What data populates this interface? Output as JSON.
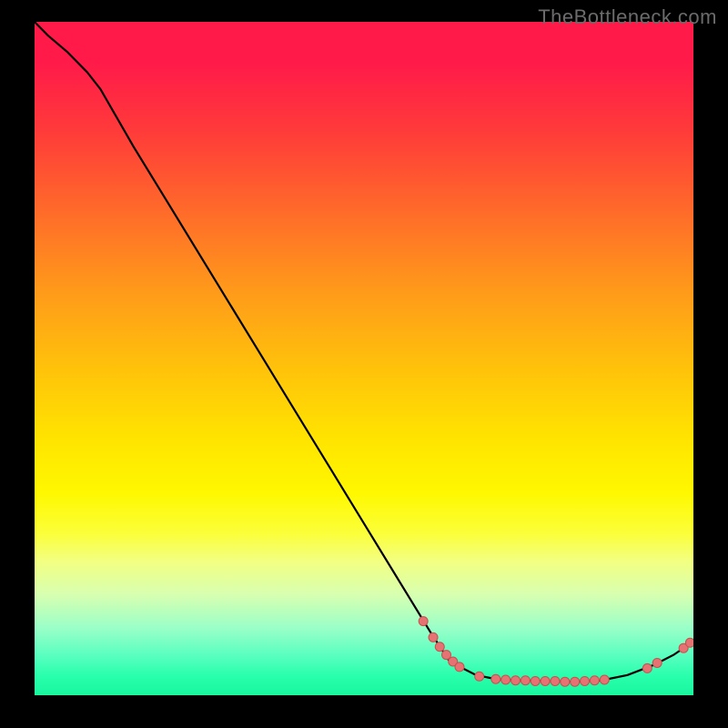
{
  "watermark": "TheBottleneck.com",
  "chart_data": {
    "type": "line",
    "title": "",
    "xlabel": "",
    "ylabel": "",
    "xlim": [
      0,
      100
    ],
    "ylim": [
      0,
      100
    ],
    "grid": false,
    "colors": {
      "line": "#000000",
      "marker_fill": "#e57373",
      "marker_stroke": "#c94f4f",
      "gradient_top": "#ff1a4a",
      "gradient_bottom": "#18f79e"
    },
    "curve": [
      {
        "x": 0.0,
        "y": 100.0
      },
      {
        "x": 2.0,
        "y": 98.0
      },
      {
        "x": 5.0,
        "y": 95.5
      },
      {
        "x": 8.0,
        "y": 92.5
      },
      {
        "x": 10.0,
        "y": 90.0
      },
      {
        "x": 15.0,
        "y": 81.5
      },
      {
        "x": 20.0,
        "y": 73.5
      },
      {
        "x": 25.0,
        "y": 65.5
      },
      {
        "x": 30.0,
        "y": 57.5
      },
      {
        "x": 35.0,
        "y": 49.5
      },
      {
        "x": 40.0,
        "y": 41.5
      },
      {
        "x": 45.0,
        "y": 33.5
      },
      {
        "x": 50.0,
        "y": 25.5
      },
      {
        "x": 55.0,
        "y": 17.5
      },
      {
        "x": 60.0,
        "y": 9.5
      },
      {
        "x": 63.0,
        "y": 5.0
      },
      {
        "x": 67.0,
        "y": 3.0
      },
      {
        "x": 70.0,
        "y": 2.4
      },
      {
        "x": 74.0,
        "y": 2.2
      },
      {
        "x": 78.0,
        "y": 2.1
      },
      {
        "x": 82.0,
        "y": 2.0
      },
      {
        "x": 86.0,
        "y": 2.2
      },
      {
        "x": 90.0,
        "y": 3.0
      },
      {
        "x": 94.0,
        "y": 4.5
      },
      {
        "x": 97.0,
        "y": 6.0
      },
      {
        "x": 100.0,
        "y": 8.0
      }
    ],
    "markers": [
      {
        "x": 59.0,
        "y": 11.0
      },
      {
        "x": 60.5,
        "y": 8.6
      },
      {
        "x": 61.5,
        "y": 7.2
      },
      {
        "x": 62.5,
        "y": 6.0
      },
      {
        "x": 63.5,
        "y": 5.0
      },
      {
        "x": 64.5,
        "y": 4.2
      },
      {
        "x": 67.5,
        "y": 2.8
      },
      {
        "x": 70.0,
        "y": 2.4
      },
      {
        "x": 71.5,
        "y": 2.3
      },
      {
        "x": 73.0,
        "y": 2.2
      },
      {
        "x": 74.5,
        "y": 2.2
      },
      {
        "x": 76.0,
        "y": 2.1
      },
      {
        "x": 77.5,
        "y": 2.1
      },
      {
        "x": 79.0,
        "y": 2.1
      },
      {
        "x": 80.5,
        "y": 2.0
      },
      {
        "x": 82.0,
        "y": 2.0
      },
      {
        "x": 83.5,
        "y": 2.1
      },
      {
        "x": 85.0,
        "y": 2.2
      },
      {
        "x": 86.5,
        "y": 2.3
      },
      {
        "x": 93.0,
        "y": 4.0
      },
      {
        "x": 94.5,
        "y": 4.8
      },
      {
        "x": 98.5,
        "y": 7.0
      },
      {
        "x": 99.5,
        "y": 7.8
      }
    ]
  }
}
